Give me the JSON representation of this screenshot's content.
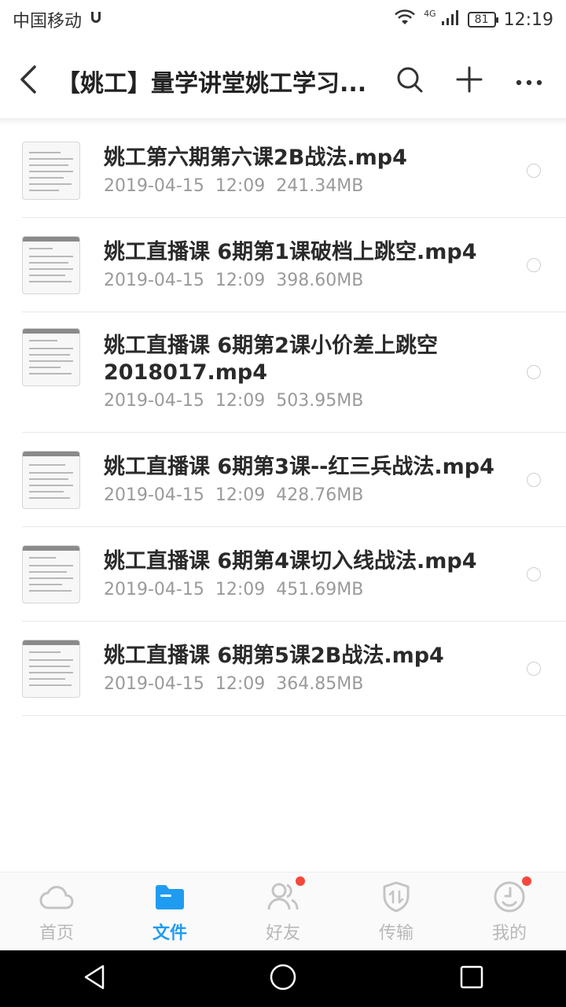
{
  "status_bar": {
    "carrier": "中国移动",
    "network": "4G",
    "battery": "81",
    "time": "12:19"
  },
  "header": {
    "title": "【姚工】量学讲堂姚工学习...",
    "icons": [
      "back-arrow-icon",
      "search-icon",
      "plus-icon",
      "more-icon"
    ]
  },
  "files": [
    {
      "name": "姚工第六期第六课2B战法.mp4",
      "date": "2019-04-15",
      "time": "12:09",
      "size": "241.34MB"
    },
    {
      "name": "姚工直播课 6期第1课破档上跳空.mp4",
      "date": "2019-04-15",
      "time": "12:09",
      "size": "398.60MB"
    },
    {
      "name": "姚工直播课 6期第2课小价差上跳空2018017.mp4",
      "date": "2019-04-15",
      "time": "12:09",
      "size": "503.95MB"
    },
    {
      "name": "姚工直播课 6期第3课--红三兵战法.mp4",
      "date": "2019-04-15",
      "time": "12:09",
      "size": "428.76MB"
    },
    {
      "name": "姚工直播课 6期第4课切入线战法.mp4",
      "date": "2019-04-15",
      "time": "12:09",
      "size": "451.69MB"
    },
    {
      "name": "姚工直播课 6期第5课2B战法.mp4",
      "date": "2019-04-15",
      "time": "12:09",
      "size": "364.85MB"
    }
  ],
  "tabs": [
    {
      "label": "首页",
      "icon": "cloud-icon",
      "active": false,
      "badge": false
    },
    {
      "label": "文件",
      "icon": "folder-icon",
      "active": true,
      "badge": false
    },
    {
      "label": "好友",
      "icon": "friends-icon",
      "active": false,
      "badge": true
    },
    {
      "label": "传输",
      "icon": "transfer-icon",
      "active": false,
      "badge": false
    },
    {
      "label": "我的",
      "icon": "profile-icon",
      "active": false,
      "badge": true
    }
  ],
  "colors": {
    "accent": "#1f9cf0",
    "badge": "#f5483d",
    "inactive_tab": "#b8b8b8"
  }
}
